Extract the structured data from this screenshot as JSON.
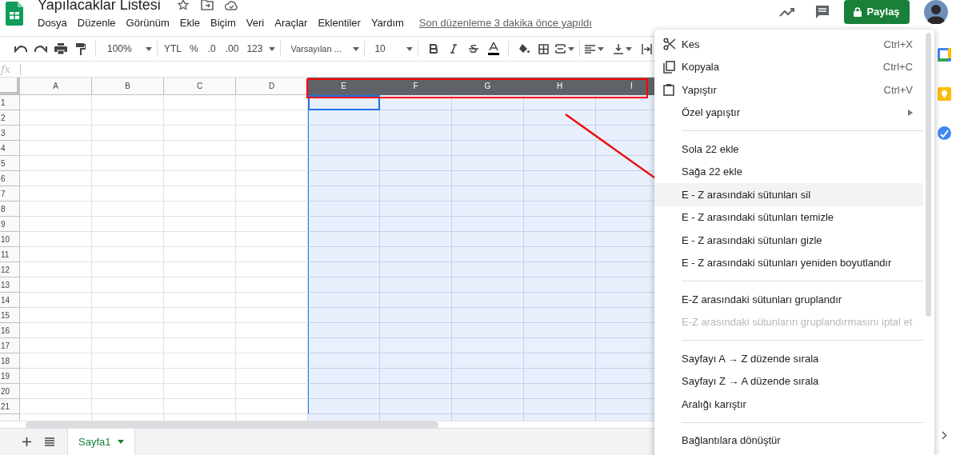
{
  "document": {
    "title": "Yapılacaklar Listesi",
    "last_edit": "Son düzenleme 3 dakika önce yapıldı"
  },
  "menu_bar": [
    "Dosya",
    "Düzenle",
    "Görünüm",
    "Ekle",
    "Biçim",
    "Veri",
    "Araçlar",
    "Eklentiler",
    "Yardım"
  ],
  "share_button": {
    "label": "Paylaş"
  },
  "toolbar": {
    "zoom": "100%",
    "currency": "YTL",
    "percent": "%",
    "decimal_decrease": ".0",
    "decimal_increase": ".00",
    "number_format": "123",
    "font": "Varsayılan ...",
    "font_size": "10"
  },
  "formula_bar": {
    "label": "fx"
  },
  "grid": {
    "columns": [
      {
        "label": "A",
        "selected": false
      },
      {
        "label": "B",
        "selected": false
      },
      {
        "label": "C",
        "selected": false
      },
      {
        "label": "D",
        "selected": false
      },
      {
        "label": "E",
        "selected": true
      },
      {
        "label": "F",
        "selected": true
      },
      {
        "label": "G",
        "selected": true
      },
      {
        "label": "H",
        "selected": true
      },
      {
        "label": "I",
        "selected": true
      }
    ],
    "rows": [
      "1",
      "2",
      "3",
      "4",
      "5",
      "6",
      "7",
      "8",
      "9",
      "10",
      "11",
      "12",
      "13",
      "14",
      "15",
      "16",
      "17",
      "18",
      "19",
      "20",
      "21"
    ]
  },
  "context_menu": [
    {
      "kind": "item",
      "label": "Kes",
      "shortcut": "Ctrl+X",
      "selected": false,
      "disabled": false
    },
    {
      "kind": "item",
      "label": "Kopyala",
      "shortcut": "Ctrl+C",
      "selected": false,
      "disabled": false
    },
    {
      "kind": "item",
      "label": "Yapıştır",
      "shortcut": "Ctrl+V",
      "selected": false,
      "disabled": false
    },
    {
      "kind": "submenu",
      "label": "Özel yapıştır",
      "selected": false,
      "disabled": false
    },
    {
      "kind": "separator"
    },
    {
      "kind": "item",
      "label": "Sola 22 ekle",
      "selected": false,
      "disabled": false
    },
    {
      "kind": "item",
      "label": "Sağa 22 ekle",
      "selected": false,
      "disabled": false
    },
    {
      "kind": "item",
      "label": "E - Z arasındaki sütunları sil",
      "selected": true,
      "disabled": false
    },
    {
      "kind": "item",
      "label": "E - Z arasındaki sütunları temizle",
      "selected": false,
      "disabled": false
    },
    {
      "kind": "item",
      "label": "E - Z arasındaki sütunları gizle",
      "selected": false,
      "disabled": false
    },
    {
      "kind": "item",
      "label": "E - Z arasındaki sütunları yeniden boyutlandır",
      "selected": false,
      "disabled": false
    },
    {
      "kind": "separator"
    },
    {
      "kind": "item",
      "label": "E-Z arasındaki sütunları gruplandır",
      "selected": false,
      "disabled": false
    },
    {
      "kind": "item",
      "label": "E-Z arasındaki sütunların gruplandırmasını iptal et",
      "selected": false,
      "disabled": true
    },
    {
      "kind": "separator"
    },
    {
      "kind": "item",
      "label": "Sayfayı A → Z düzende sırala",
      "selected": false,
      "disabled": false
    },
    {
      "kind": "item",
      "label": "Sayfayı Z → A düzende sırala",
      "selected": false,
      "disabled": false
    },
    {
      "kind": "item",
      "label": "Aralığı karıştır",
      "selected": false,
      "disabled": false
    },
    {
      "kind": "separator"
    },
    {
      "kind": "item",
      "label": "Bağlantılara dönüştür",
      "selected": false,
      "disabled": false
    }
  ],
  "sheet_tabs": [
    {
      "label": "Sayfa1",
      "selected": true
    }
  ]
}
